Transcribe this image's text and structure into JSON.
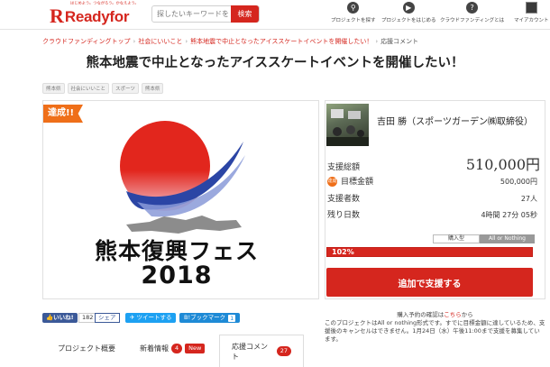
{
  "header": {
    "logo_mark": "R",
    "logo_text": "Readyfor",
    "logo_tagline": "はじめよう。つながろう。かなえよう。",
    "search_placeholder": "探したいキーワードを",
    "search_button": "検索",
    "nav": [
      {
        "label": "プロジェクトを探す",
        "icon": "search-icon"
      },
      {
        "label": "プロジェクトをはじめる",
        "icon": "play-icon"
      },
      {
        "label": "クラウドファンディングとは",
        "icon": "question-icon"
      },
      {
        "label": "マイアカウント",
        "icon": "avatar-icon"
      }
    ]
  },
  "breadcrumb": {
    "items": [
      "クラウドファンディングトップ",
      "社会にいいこと",
      "熊本地震で中止となったアイススケートイベントを開催したい！",
      "応援コメント"
    ],
    "separator": "›"
  },
  "project": {
    "title": "熊本地震で中止となったアイススケートイベントを開催したい！",
    "tags": [
      "熊本県",
      "社会にいいこと",
      "スポーツ",
      "熊本県"
    ],
    "achieved_label": "達成!!",
    "image_text": "熊本復興フェス",
    "image_year": "2018",
    "colors": {
      "accent": "#d5261e",
      "achieved": "#ef6f19",
      "sun": "#e2261d",
      "swoosh": "#2b45a5"
    }
  },
  "stats": {
    "owner_name": "吉田 勝（スポーツガーデン㈱取締役）",
    "total_label": "支援総額",
    "total_value": "510,000円",
    "goal_badge": "達成",
    "goal_label": "目標金額",
    "goal_value": "500,000円",
    "supporters_label": "支援者数",
    "supporters_value": "27人",
    "remaining_label": "残り日数",
    "remaining_value": "4時間 27分 05秒",
    "toggle_a": "購入型",
    "toggle_b": "All or Nothing",
    "progress_label": "102%",
    "progress_percent": 102,
    "support_button": "追加で支援する"
  },
  "social": {
    "fb_like": "いいね!",
    "fb_count": "182",
    "share": "シェア",
    "tweet": "ツイートする",
    "hatena": "B!ブックマーク",
    "hatena_count": "1"
  },
  "notes": {
    "line1_prefix": "購入予約の確認は",
    "line1_link": "こちら",
    "line1_suffix": "から",
    "body": "このプロジェクトはAll or nothing形式です。すでに目標金額に達しているため、支援後のキャンセルはできません。1月24日（水）午後11:00まで支援を募集しています。"
  },
  "tabs": [
    {
      "label": "プロジェクト概要"
    },
    {
      "label": "新着情報",
      "badge": "4",
      "badge2": "New"
    },
    {
      "label": "応援コメント",
      "badge": "27"
    }
  ]
}
